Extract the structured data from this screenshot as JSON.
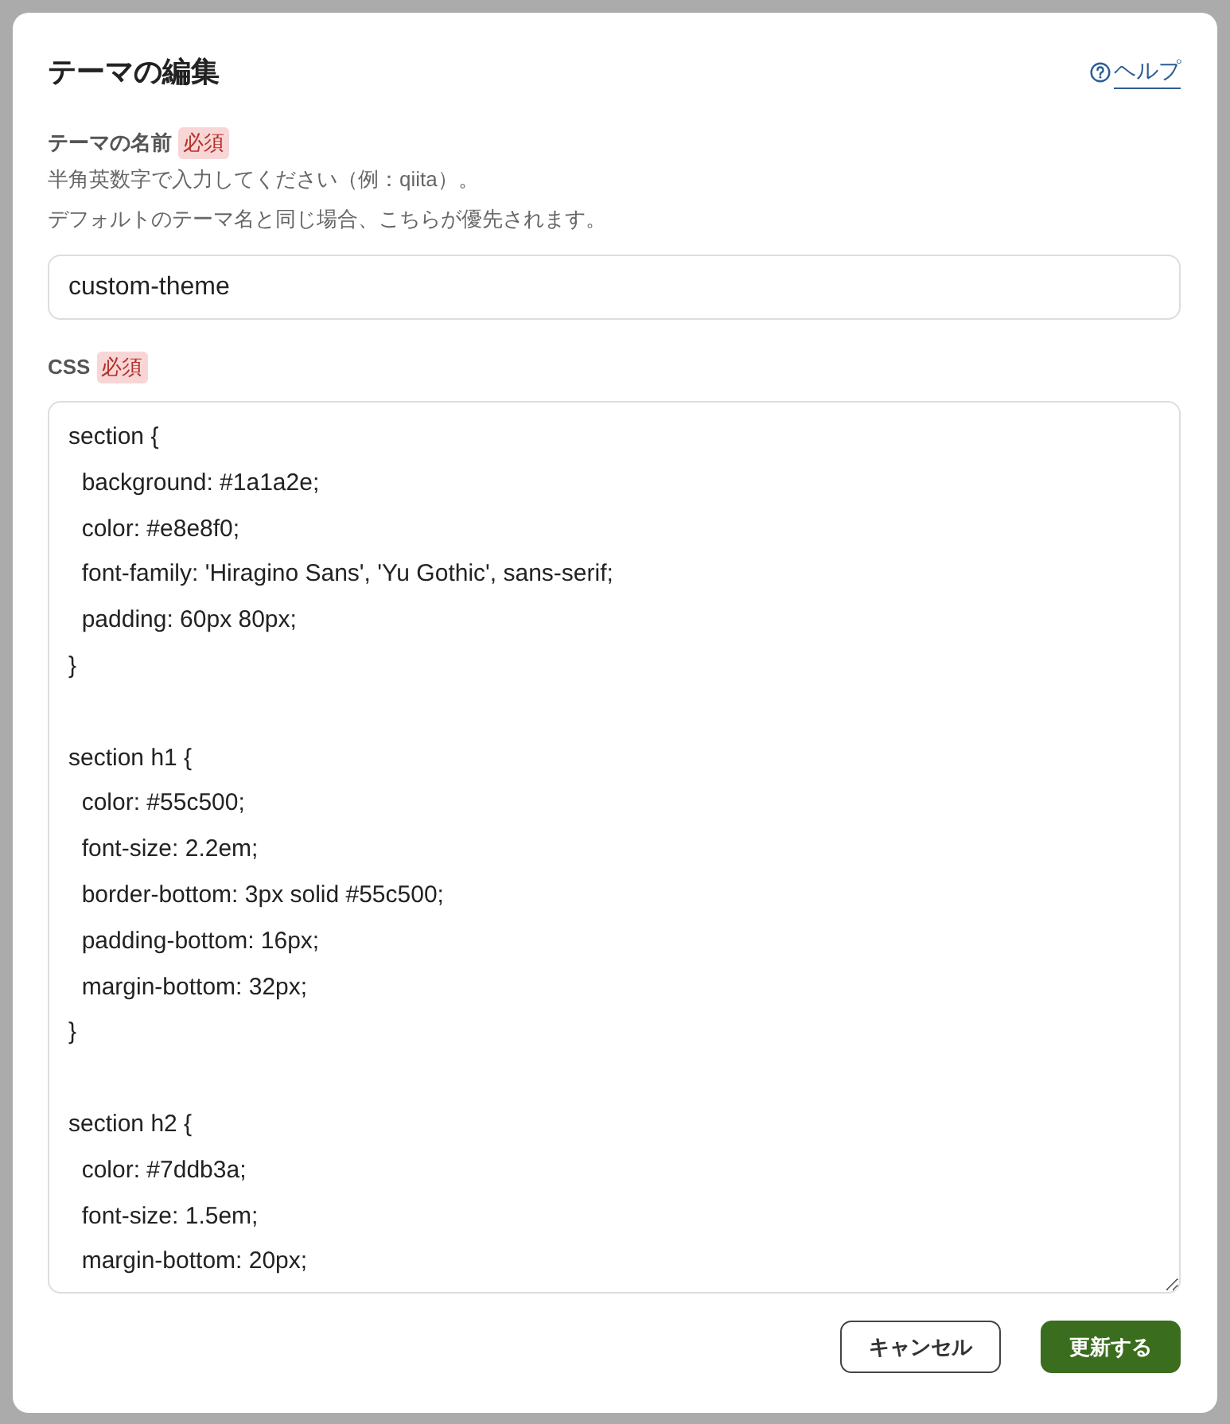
{
  "dialog": {
    "title": "テーマの編集",
    "help_link": {
      "label": "ヘルプ"
    }
  },
  "fields": [
    {
      "kind": "input",
      "label": "テーマの名前",
      "badge": "必須",
      "hints": [
        "半角英数字で入力してください（例：qiita）。",
        "デフォルトのテーマ名と同じ場合、こちらが優先されます。"
      ],
      "value": "custom-theme"
    },
    {
      "kind": "textarea",
      "label": "CSS",
      "badge": "必須",
      "value": "section {\n  background: #1a1a2e;\n  color: #e8e8f0;\n  font-family: 'Hiragino Sans', 'Yu Gothic', sans-serif;\n  padding: 60px 80px;\n}\n\nsection h1 {\n  color: #55c500;\n  font-size: 2.2em;\n  border-bottom: 3px solid #55c500;\n  padding-bottom: 16px;\n  margin-bottom: 32px;\n}\n\nsection h2 {\n  color: #7ddb3a;\n  font-size: 1.5em;\n  margin-bottom: 20px;"
    }
  ],
  "buttons": [
    {
      "label": "キャンセル",
      "kind": "secondary"
    },
    {
      "label": "更新する",
      "kind": "primary"
    }
  ]
}
